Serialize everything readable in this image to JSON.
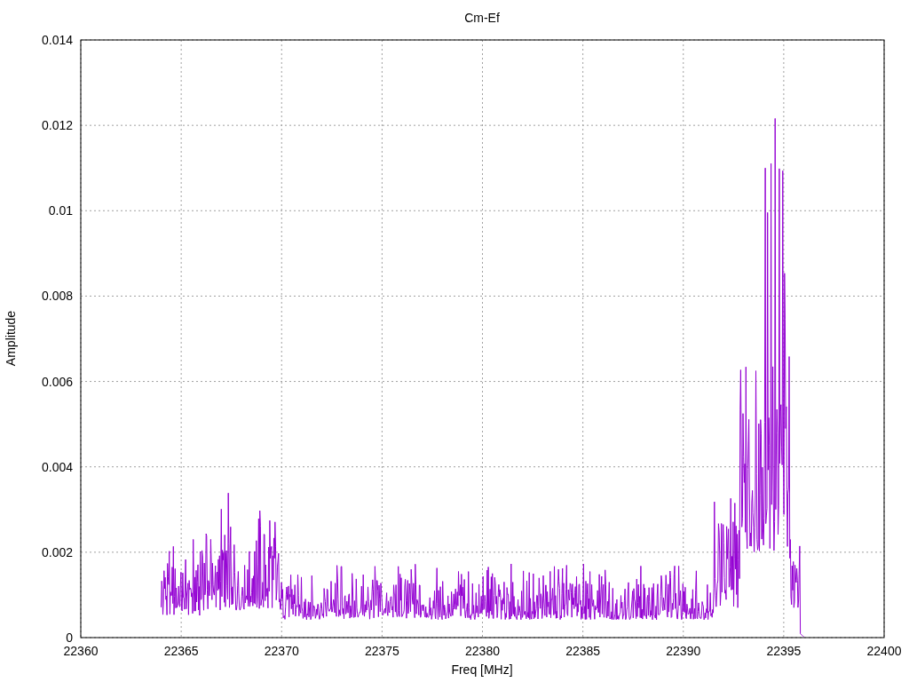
{
  "plot": {
    "title": "Cm-Ef",
    "xlabel": "Freq [MHz]",
    "ylabel": "Amplitude",
    "xticks": [
      "22360",
      "22365",
      "22370",
      "22375",
      "22380",
      "22385",
      "22390",
      "22395",
      "22400"
    ],
    "yticks": [
      "0.014",
      "0.012",
      "0.01",
      "0.008",
      "0.006",
      "0.004",
      "0.002",
      "0"
    ]
  }
}
